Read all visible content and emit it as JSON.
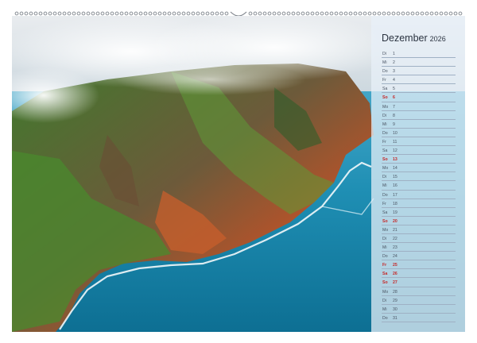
{
  "calendar": {
    "month": "Dezember",
    "year": "2026",
    "days": [
      {
        "wd": "Di",
        "d": "1"
      },
      {
        "wd": "Mi",
        "d": "2"
      },
      {
        "wd": "Do",
        "d": "3"
      },
      {
        "wd": "Fr",
        "d": "4"
      },
      {
        "wd": "Sa",
        "d": "5"
      },
      {
        "wd": "So",
        "d": "6",
        "sun": true
      },
      {
        "wd": "Mo",
        "d": "7"
      },
      {
        "wd": "Di",
        "d": "8"
      },
      {
        "wd": "Mi",
        "d": "9"
      },
      {
        "wd": "Do",
        "d": "10"
      },
      {
        "wd": "Fr",
        "d": "11"
      },
      {
        "wd": "Sa",
        "d": "12"
      },
      {
        "wd": "So",
        "d": "13",
        "sun": true
      },
      {
        "wd": "Mo",
        "d": "14"
      },
      {
        "wd": "Di",
        "d": "15"
      },
      {
        "wd": "Mi",
        "d": "16"
      },
      {
        "wd": "Do",
        "d": "17"
      },
      {
        "wd": "Fr",
        "d": "18"
      },
      {
        "wd": "Sa",
        "d": "19"
      },
      {
        "wd": "So",
        "d": "20",
        "sun": true
      },
      {
        "wd": "Mo",
        "d": "21"
      },
      {
        "wd": "Di",
        "d": "22"
      },
      {
        "wd": "Mi",
        "d": "23"
      },
      {
        "wd": "Do",
        "d": "24"
      },
      {
        "wd": "Fr",
        "d": "25",
        "sun": true
      },
      {
        "wd": "Sa",
        "d": "26",
        "sun": true
      },
      {
        "wd": "So",
        "d": "27",
        "sun": true
      },
      {
        "wd": "Mo",
        "d": "28"
      },
      {
        "wd": "Di",
        "d": "29"
      },
      {
        "wd": "Mi",
        "d": "30"
      },
      {
        "wd": "Do",
        "d": "31"
      }
    ]
  },
  "colors": {
    "holiday": "#c62828",
    "text": "#2b3340",
    "line": "#9fb1c4"
  }
}
